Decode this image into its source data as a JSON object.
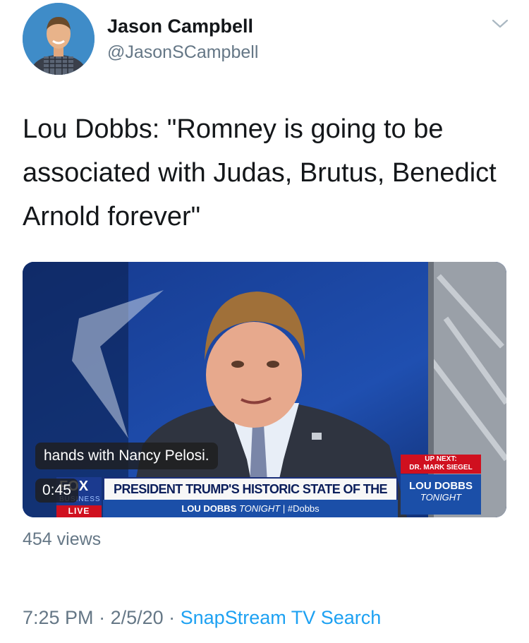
{
  "user": {
    "name": "Jason Campbell",
    "handle": "@JasonSCampbell"
  },
  "tweet": {
    "text": "Lou Dobbs: \"Romney is going to be associated with Judas, Brutus, Benedict Arnold forever\""
  },
  "video": {
    "caption": "hands with Nancy Pelosi.",
    "duration": "0:45",
    "ticker_main": "PRESIDENT TRUMP'S HISTORIC STATE OF THE UNION",
    "ticker_show": "LOU DOBBS",
    "ticker_show_suffix": "TONIGHT",
    "ticker_hashtag": "| #Dobbs",
    "network": "FOX",
    "network_sub": "BUSINESS",
    "live": "LIVE",
    "up_next_label": "UP NEXT:",
    "up_next_guest": "DR. MARK SIEGEL",
    "show_logo_title": "LOU DOBBS",
    "show_logo_sub": "TONIGHT"
  },
  "stats": {
    "views": "454 views"
  },
  "meta": {
    "time": "7:25 PM",
    "date": "2/5/20",
    "separator": " · ",
    "source": "SnapStream TV Search"
  },
  "icons": {
    "menu": "chevron-down-icon"
  },
  "colors": {
    "link": "#1da1f2",
    "secondary": "#657786",
    "text": "#14171a"
  }
}
